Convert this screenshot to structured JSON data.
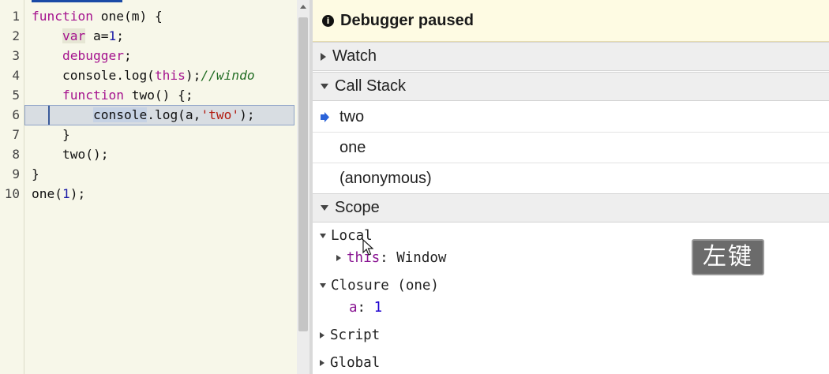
{
  "editor": {
    "line_numbers": [
      "1",
      "2",
      "3",
      "4",
      "5",
      "6",
      "7",
      "8",
      "9",
      "10"
    ],
    "lines": [
      [
        {
          "t": "function",
          "c": "kw"
        },
        {
          "t": " one("
        },
        {
          "t": "m"
        },
        {
          "t": ") {"
        }
      ],
      [
        {
          "t": "    "
        },
        {
          "t": "var",
          "c": "kw"
        },
        {
          "t": " a="
        },
        {
          "t": "1",
          "c": "nm"
        },
        {
          "t": ";"
        }
      ],
      [
        {
          "t": "    "
        },
        {
          "t": "debugger",
          "c": "kw"
        },
        {
          "t": ";"
        }
      ],
      [
        {
          "t": "    console.log("
        },
        {
          "t": "this",
          "c": "kw"
        },
        {
          "t": ");"
        },
        {
          "t": "//windo",
          "c": "cm"
        }
      ],
      [
        {
          "t": "    "
        },
        {
          "t": "function",
          "c": "kw"
        },
        {
          "t": " two() {;"
        }
      ],
      [
        {
          "t": "        "
        },
        {
          "t": "console",
          "c": "sel"
        },
        {
          "t": ".log(a,"
        },
        {
          "t": "'two'",
          "c": "st"
        },
        {
          "t": ");"
        }
      ],
      [
        {
          "t": "    }"
        }
      ],
      [
        {
          "t": "    two();"
        }
      ],
      [
        {
          "t": "}"
        }
      ],
      [
        {
          "t": "one("
        },
        {
          "t": "1",
          "c": "nm"
        },
        {
          "t": ");"
        }
      ]
    ]
  },
  "debugger": {
    "paused_label": "Debugger paused",
    "info_icon": "info-icon",
    "sections": {
      "watch": "Watch",
      "call_stack": "Call Stack",
      "scope": "Scope"
    },
    "call_stack": [
      "two",
      "one",
      "(anonymous)"
    ],
    "current_frame_index": 0,
    "scope": {
      "local_label": "Local",
      "this_name": "this",
      "this_sep": ": ",
      "this_value": "Window",
      "closure_label": "Closure (one)",
      "closure_var_name": "a",
      "closure_var_sep": ": ",
      "closure_var_value": "1",
      "script_label": "Script",
      "global_label": "Global"
    }
  },
  "overlay": {
    "key_badge": "左键"
  }
}
